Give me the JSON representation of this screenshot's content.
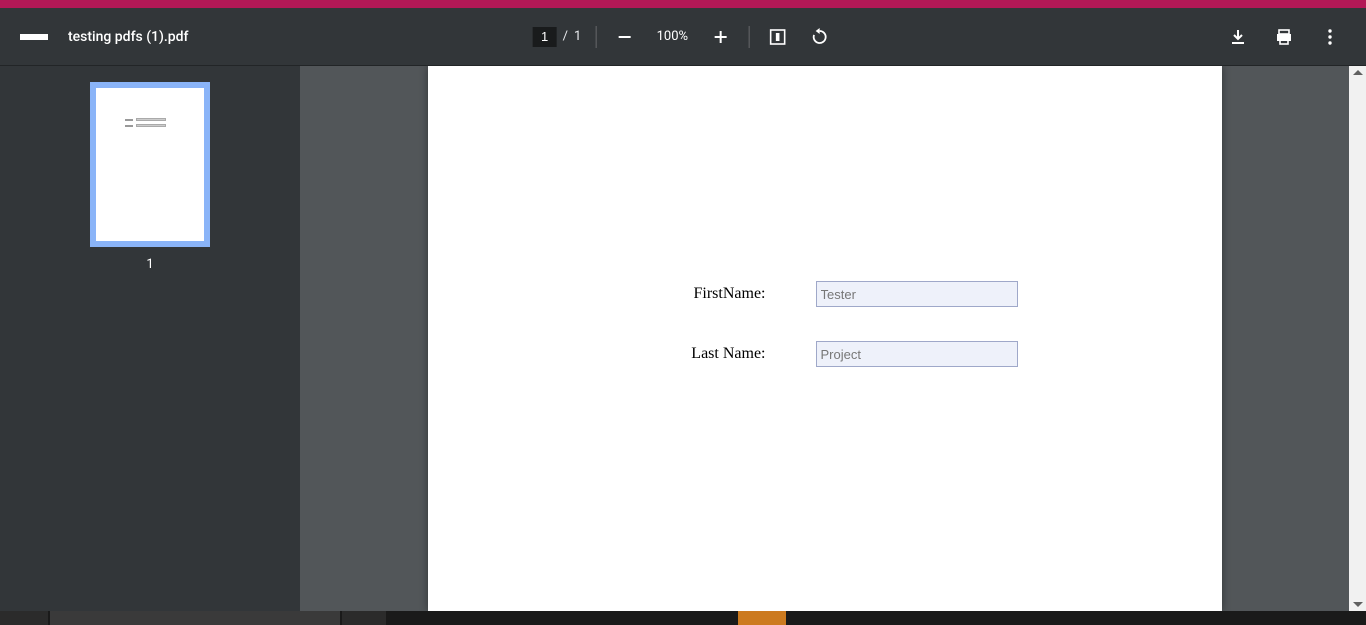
{
  "accent_color": "#b31856",
  "filename": "testing pdfs (1).pdf",
  "pages": {
    "current": "1",
    "separator": "/",
    "total": "1"
  },
  "zoom": "100%",
  "thumbnail": {
    "number": "1"
  },
  "form": {
    "first_name_label": "FirstName:",
    "first_name_value": "Tester",
    "last_name_label": "Last Name:",
    "last_name_value": "Project"
  },
  "icons": {
    "menu": "menu",
    "zoom_out": "zoom-out",
    "zoom_in": "zoom-in",
    "fit": "fit-to-page",
    "rotate": "rotate",
    "download": "download",
    "print": "print",
    "more": "more"
  }
}
